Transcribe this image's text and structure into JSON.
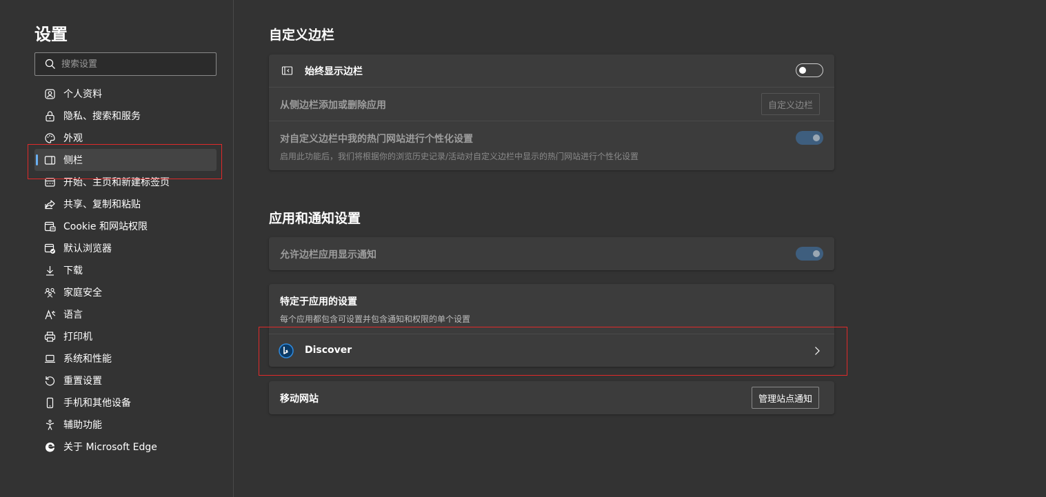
{
  "sidebar": {
    "title": "设置",
    "search_placeholder": "搜索设置",
    "items": [
      {
        "label": "个人资料"
      },
      {
        "label": "隐私、搜索和服务"
      },
      {
        "label": "外观"
      },
      {
        "label": "侧栏",
        "active": true
      },
      {
        "label": "开始、主页和新建标签页"
      },
      {
        "label": "共享、复制和粘贴"
      },
      {
        "label": "Cookie 和网站权限"
      },
      {
        "label": "默认浏览器"
      },
      {
        "label": "下载"
      },
      {
        "label": "家庭安全"
      },
      {
        "label": "语言"
      },
      {
        "label": "打印机"
      },
      {
        "label": "系统和性能"
      },
      {
        "label": "重置设置"
      },
      {
        "label": "手机和其他设备"
      },
      {
        "label": "辅助功能"
      },
      {
        "label": "关于 Microsoft Edge"
      }
    ]
  },
  "customize_sidebar": {
    "title": "自定义边栏",
    "always_show": {
      "label": "始终显示边栏",
      "enabled": false
    },
    "add_remove": {
      "label": "从侧边栏添加或删除应用",
      "button": "自定义边栏"
    },
    "personalize": {
      "label": "对自定义边栏中我的热门网站进行个性化设置",
      "desc": "启用此功能后，我们将根据你的浏览历史记录/活动对自定义边栏中显示的热门网站进行个性化设置",
      "enabled": true
    }
  },
  "app_notifications": {
    "title": "应用和通知设置",
    "allow_notifications": {
      "label": "允许边栏应用显示通知",
      "enabled": true
    },
    "app_specific": {
      "label": "特定于应用的设置",
      "desc": "每个应用都包含可设置并包含通知和权限的单个设置",
      "app_name": "Discover"
    },
    "mobile_sites": {
      "label": "移动网站",
      "button": "管理站点通知"
    }
  },
  "colors": {
    "background": "#333333",
    "card": "#3c3c3c",
    "accent": "#6ab0f3",
    "highlight": "#e12a2a"
  }
}
